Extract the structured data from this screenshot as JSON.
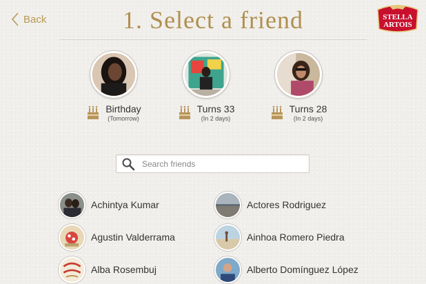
{
  "header": {
    "back_label": "Back",
    "title": "1. Select a friend",
    "logo_text_top": "STELLA",
    "logo_text_bottom": "ARTOIS"
  },
  "featured": [
    {
      "event": "Birthday",
      "when": "(Tomorrow)"
    },
    {
      "event": "Turns 33",
      "when": "(In 2 days)"
    },
    {
      "event": "Turns 28",
      "when": "(In 2 days)"
    }
  ],
  "search": {
    "placeholder": "Search friends",
    "value": ""
  },
  "friends": [
    {
      "name": "Achintya Kumar"
    },
    {
      "name": "Actores Rodriguez"
    },
    {
      "name": "Agustin Valderrama"
    },
    {
      "name": "Ainhoa Romero Piedra"
    },
    {
      "name": "Alba Rosembuj"
    },
    {
      "name": "Alberto Domínguez López"
    }
  ],
  "colors": {
    "accent": "#b08f4f",
    "background": "#f1efec",
    "brand_red": "#c8102e"
  },
  "icons": {
    "back": "chevron-left-icon",
    "search": "magnifier-icon",
    "cake": "birthday-cake-icon"
  }
}
